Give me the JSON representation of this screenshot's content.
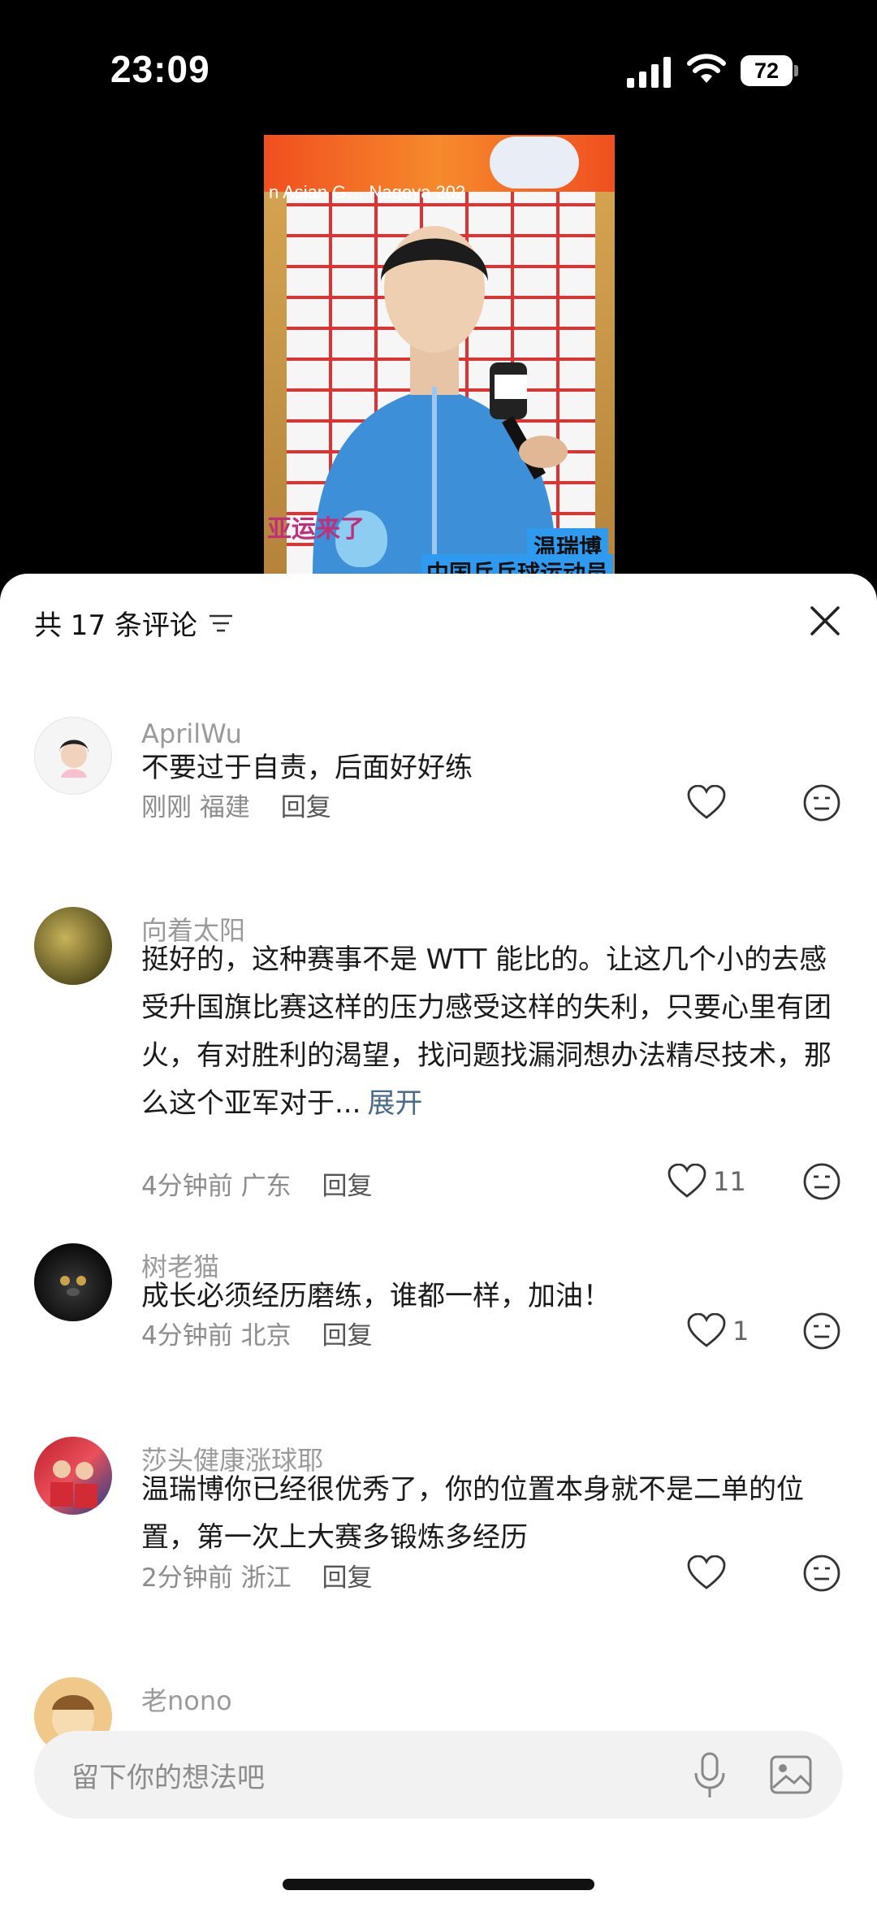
{
  "status_bar": {
    "time": "23:09",
    "battery": "72"
  },
  "video": {
    "banner_text": "n Asian G… Nagoya 202",
    "caption_name": "温瑞博",
    "caption_role": "中国乒乓球运动员",
    "logo_text": "亚运来了"
  },
  "comments_header": {
    "title": "共 17 条评论"
  },
  "comments": [
    {
      "user": "AprilWu",
      "text": "不要过于自责，后面好好练",
      "time": "刚刚",
      "location": "福建",
      "reply": "回复",
      "likes": ""
    },
    {
      "user": "向着太阳",
      "text": "挺好的，这种赛事不是 WTT 能比的。让这几个小的去感受升国旗比赛这样的压力感受这样的失利，只要心里有团火，有对胜利的渴望，找问题找漏洞想办法精尽技术，那么这个亚军对于...",
      "expand": "展开",
      "time": "4分钟前",
      "location": "广东",
      "reply": "回复",
      "likes": "11"
    },
    {
      "user": "树老猫",
      "text": "成长必须经历磨练，谁都一样，加油！",
      "time": "4分钟前",
      "location": "北京",
      "reply": "回复",
      "likes": "1"
    },
    {
      "user": "莎头健康涨球耶",
      "text": "温瑞博你已经很优秀了，你的位置本身就不是二单的位置，第一次上大赛多锻炼多经历",
      "time": "2分钟前",
      "location": "浙江",
      "reply": "回复",
      "likes": ""
    },
    {
      "user": "老nono"
    }
  ],
  "input": {
    "placeholder": "留下你的想法吧"
  },
  "colors": {
    "sheet_bg": "#ffffff",
    "input_bg": "#f2f2f2",
    "muted_text": "#8c8c8c"
  }
}
